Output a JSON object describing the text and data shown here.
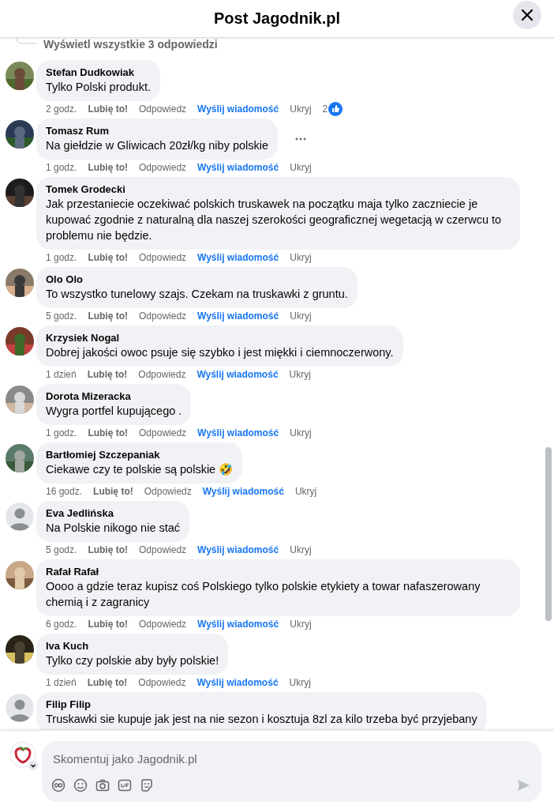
{
  "header": {
    "title": "Post Jagodnik.pl"
  },
  "view_replies": "Wyświetl wszystkie 3 odpowiedzi",
  "comments": [
    {
      "author": "Stefan Dudkowiak",
      "text": "Tylko Polski produkt.",
      "time": "2 godz.",
      "like": "Lubię to!",
      "reply": "Odpowiedz",
      "message": "Wyślij wiadomość",
      "hide": "Ukryj",
      "reactions": "2",
      "more": false
    },
    {
      "author": "Tomasz Rum",
      "text": "Na giełdzie w Gliwicach 20zł/kg niby polskie",
      "time": "1 godz.",
      "like": "Lubię to!",
      "reply": "Odpowiedz",
      "message": "Wyślij wiadomość",
      "hide": "Ukryj",
      "more": true
    },
    {
      "author": "Tomek Grodecki",
      "text": "Jak przestaniecie oczekiwać polskich truskawek na początku maja tylko zaczniecie je kupować zgodnie z naturalną dla naszej szerokości geograficznej wegetacją w czerwcu to problemu nie będzie.",
      "time": "1 godz.",
      "like": "Lubię to!",
      "reply": "Odpowiedz",
      "message": "Wyślij wiadomość",
      "hide": "Ukryj",
      "more": false
    },
    {
      "author": "Olo Olo",
      "text": "To wszystko tunelowy szajs. Czekam na truskawki z gruntu.",
      "time": "5 godz.",
      "like": "Lubię to!",
      "reply": "Odpowiedz",
      "message": "Wyślij wiadomość",
      "hide": "Ukryj",
      "more": false
    },
    {
      "author": "Krzysiek Nogal",
      "text": "Dobrej jakości owoc psuje się szybko i jest miękki i ciemnoczerwony.",
      "time": "1 dzień",
      "like": "Lubię to!",
      "reply": "Odpowiedz",
      "message": "Wyślij wiadomość",
      "hide": "Ukryj",
      "more": false
    },
    {
      "author": "Dorota Mizeracka",
      "text": "Wygra portfel kupującego .",
      "time": "1 godz.",
      "like": "Lubię to!",
      "reply": "Odpowiedz",
      "message": "Wyślij wiadomość",
      "hide": "Ukryj",
      "more": false
    },
    {
      "author": "Bartłomiej Szczepaniak",
      "text": "Ciekawe czy te polskie są polskie 🤣",
      "time": "16 godz.",
      "like": "Lubię to!",
      "reply": "Odpowiedz",
      "message": "Wyślij wiadomość",
      "hide": "Ukryj",
      "more": false
    },
    {
      "kind": "default",
      "author": "Eva Jedlińska",
      "text": "Na Polskie nikogo nie stać",
      "time": "5 godz.",
      "like": "Lubię to!",
      "reply": "Odpowiedz",
      "message": "Wyślij wiadomość",
      "hide": "Ukryj",
      "more": false
    },
    {
      "author": "Rafał Rafał",
      "text": "Oooo a gdzie teraz kupisz coś Polskiego tylko polskie etykiety a towar nafaszerowany chemią i z zagranicy",
      "time": "6 godz.",
      "like": "Lubię to!",
      "reply": "Odpowiedz",
      "message": "Wyślij wiadomość",
      "hide": "Ukryj",
      "more": false
    },
    {
      "author": "Iva Kuch",
      "text": "Tylko czy polskie aby były polskie!",
      "time": "1 dzień",
      "like": "Lubię to!",
      "reply": "Odpowiedz",
      "message": "Wyślij wiadomość",
      "hide": "Ukryj",
      "more": false
    },
    {
      "kind": "default",
      "author": "Filip Filip",
      "text": "Truskawki sie kupuje jak jest na nie sezon i kosztuja 8zl za kilo trzeba być przyjebany"
    }
  ],
  "composer": {
    "placeholder": "Skomentuj jako Jagodnik.pl"
  }
}
